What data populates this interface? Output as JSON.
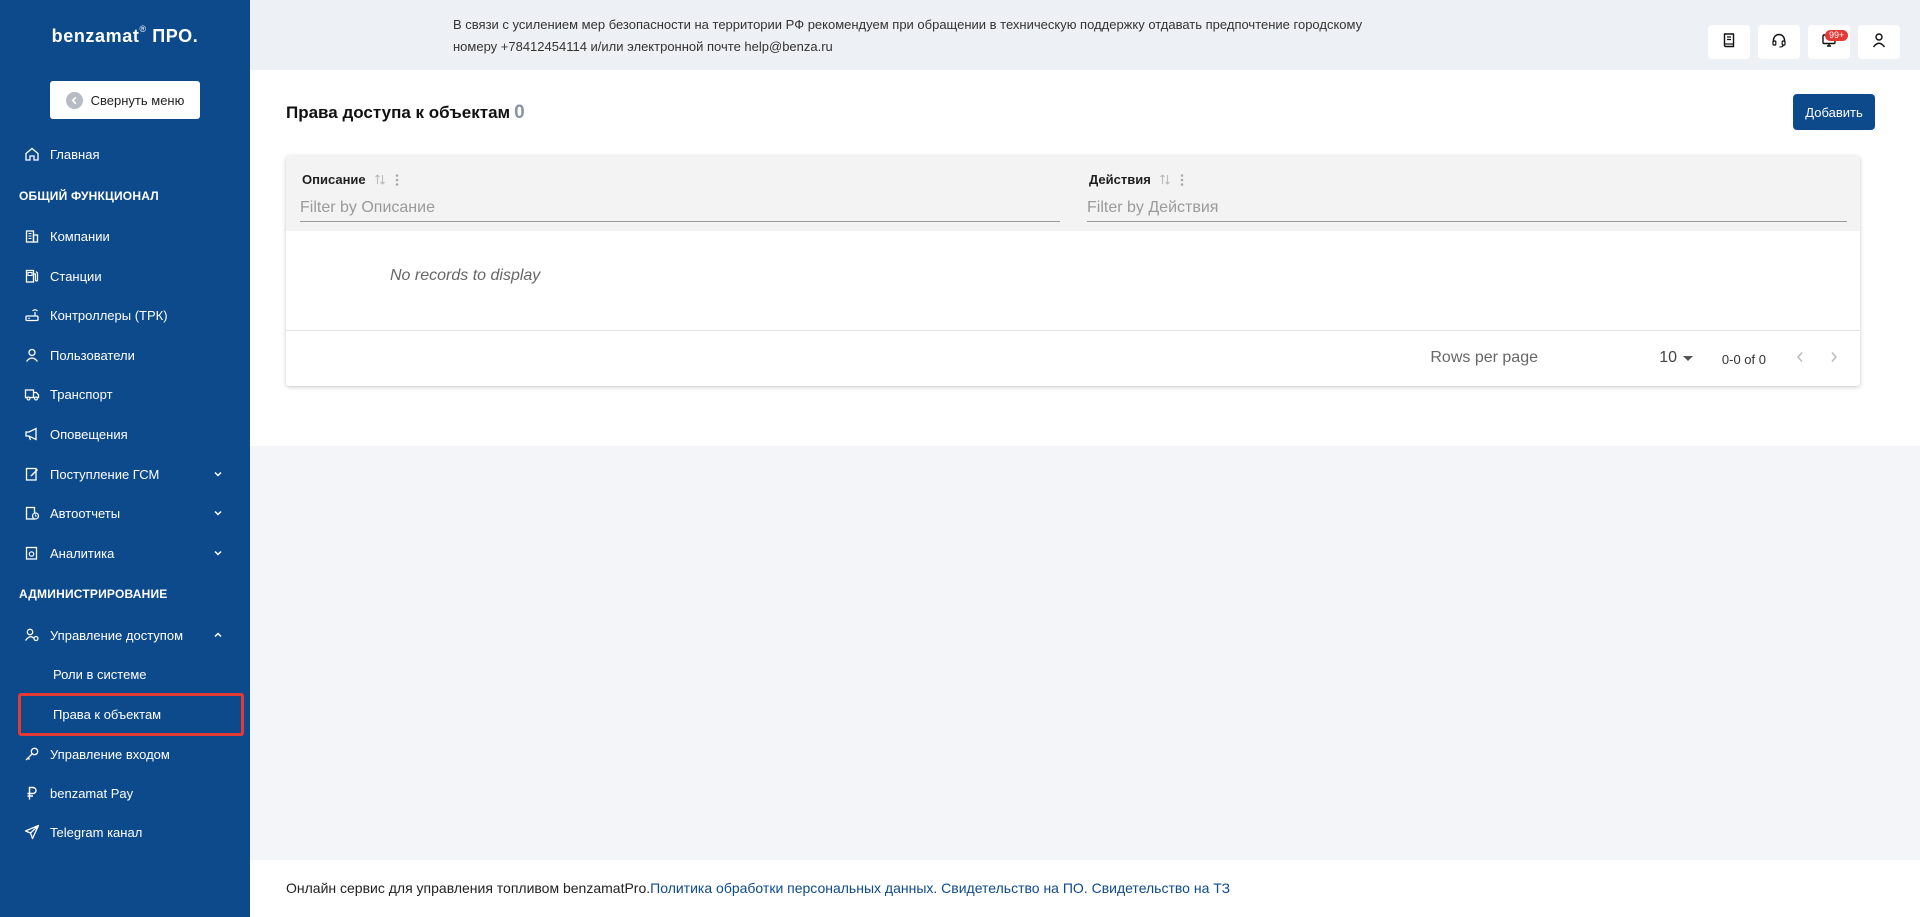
{
  "sidebar": {
    "logo_brand": "benzamat",
    "logo_mark": "®",
    "logo_suffix": " ПРО.",
    "collapse_label": "Свернуть меню",
    "home": "Главная",
    "section_general": "ОБЩИЙ ФУНКЦИОНАЛ",
    "companies": "Компании",
    "stations": "Станции",
    "controllers": "Контроллеры (ТРК)",
    "users": "Пользователи",
    "transport": "Транспорт",
    "notifications": "Оповещения",
    "fuel_receipt": "Поступление ГСМ",
    "autoreports": "Автоотчеты",
    "analytics": "Аналитика",
    "section_admin": "АДМИНИСТРИРОВАНИЕ",
    "access_management": "Управление доступом",
    "roles": "Роли в системе",
    "object_rights": "Права к объектам",
    "login_management": "Управление входом",
    "pay": "benzamat Pay",
    "telegram": "Telegram канал"
  },
  "topbar": {
    "notice_line1": "В связи с усилением мер безопасности на территории РФ рекомендуем при обращении в техническую поддержку отдавать предпочтение городскому",
    "notice_line2": "номеру +78412454114 и/или электронной почте help@benza.ru",
    "notifications_badge": "99+"
  },
  "main": {
    "title": "Права доступа к объектам",
    "count": "0",
    "add_label": "Добавить",
    "table": {
      "columns": [
        {
          "label": "Описание",
          "filter_placeholder": "Filter by Описание"
        },
        {
          "label": "Действия",
          "filter_placeholder": "Filter by Действия"
        }
      ],
      "empty_text": "No records to display",
      "rows_per_page_label": "Rows per page",
      "rows_per_page_value": "10",
      "range": "0-0 of 0"
    }
  },
  "footer": {
    "text": "Онлайн сервис для управления топливом benzamatPro.",
    "link_privacy": "Политика обработки персональных данных.",
    "link_software": "Свидетельство на ПО.",
    "link_trademark": "Свидетельство на ТЗ"
  },
  "colors": {
    "sidebar_bg": "#0d4a8b",
    "accent": "#0d4a8b",
    "highlight": "#e53935",
    "badge": "#e53935"
  }
}
